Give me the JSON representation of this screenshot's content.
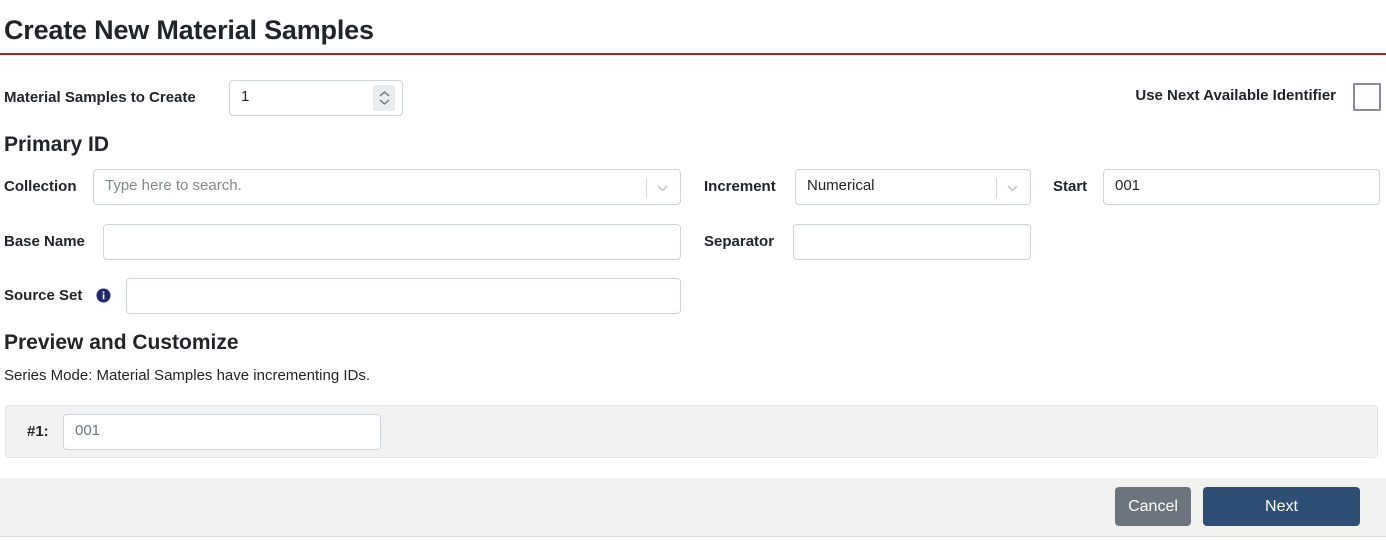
{
  "title": "Create New Material Samples",
  "accent": {
    "title_rule": "#9e2a2b",
    "primary_button": "#2e4f75",
    "secondary_button": "#6c757d",
    "info_icon": "#1a2a6c"
  },
  "top_row": {
    "samples_label": "Material Samples to Create",
    "samples_value": "1",
    "spinner_icon": "number-spinner-icon",
    "use_next_identifier_label": "Use Next Available Identifier",
    "use_next_identifier_checked": false
  },
  "primary_id": {
    "heading": "Primary ID",
    "collection": {
      "label": "Collection",
      "placeholder": "Type here to search.",
      "value": "",
      "chevron_icon": "chevron-down-icon"
    },
    "increment": {
      "label": "Increment",
      "value": "Numerical",
      "chevron_icon": "chevron-down-icon"
    },
    "start": {
      "label": "Start",
      "value": "001",
      "placeholder": ""
    },
    "base_name": {
      "label": "Base Name",
      "value": "",
      "placeholder": ""
    },
    "separator": {
      "label": "Separator",
      "value": "",
      "placeholder": ""
    },
    "source_set": {
      "label": "Source Set",
      "info_icon": "info-icon",
      "value": "",
      "placeholder": ""
    }
  },
  "preview": {
    "heading": "Preview and Customize",
    "series_note": "Series Mode: Material Samples have incrementing IDs.",
    "rows": [
      {
        "label": "#1:",
        "value": "001"
      }
    ]
  },
  "footer": {
    "cancel_label": "Cancel",
    "next_label": "Next"
  }
}
